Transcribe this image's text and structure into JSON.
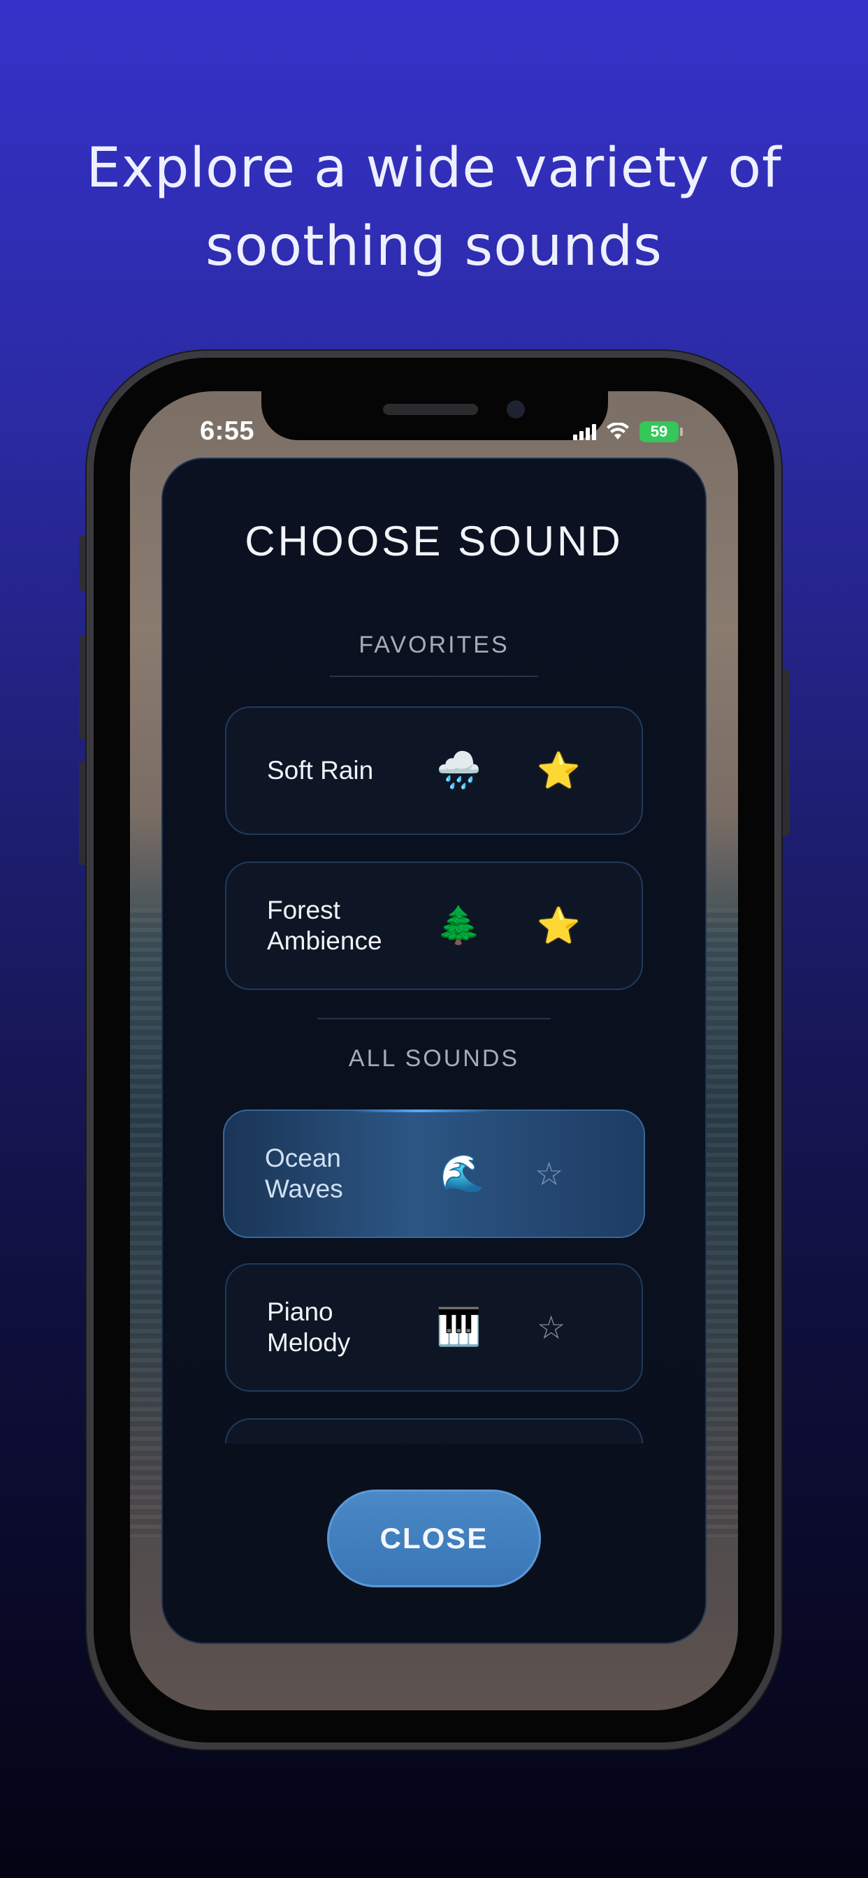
{
  "headline": {
    "line1": "Explore a wide variety of",
    "line2": "soothing sounds"
  },
  "status_bar": {
    "time": "6:55",
    "battery": "59",
    "icons": [
      "signal-icon",
      "wifi-icon",
      "battery-icon"
    ]
  },
  "modal": {
    "title": "CHOOSE SOUND",
    "favorites_label": "FAVORITES",
    "all_sounds_label": "ALL SOUNDS",
    "close_label": "CLOSE"
  },
  "favorites": [
    {
      "name": "Soft Rain",
      "emoji": "🌧️",
      "star": "⭐",
      "favorited": true
    },
    {
      "name": "Forest Ambience",
      "emoji": "🌲",
      "star": "⭐",
      "favorited": true
    }
  ],
  "all_sounds": [
    {
      "name": "Ocean Waves",
      "emoji": "🌊",
      "star": "☆",
      "favorited": false,
      "selected": true
    },
    {
      "name": "Piano Melody",
      "emoji": "🎹",
      "star": "☆",
      "favorited": false,
      "selected": false
    }
  ],
  "colors": {
    "accent": "#3a76b6",
    "background_top": "#3532c9",
    "card_border": "#1f3a5c"
  }
}
